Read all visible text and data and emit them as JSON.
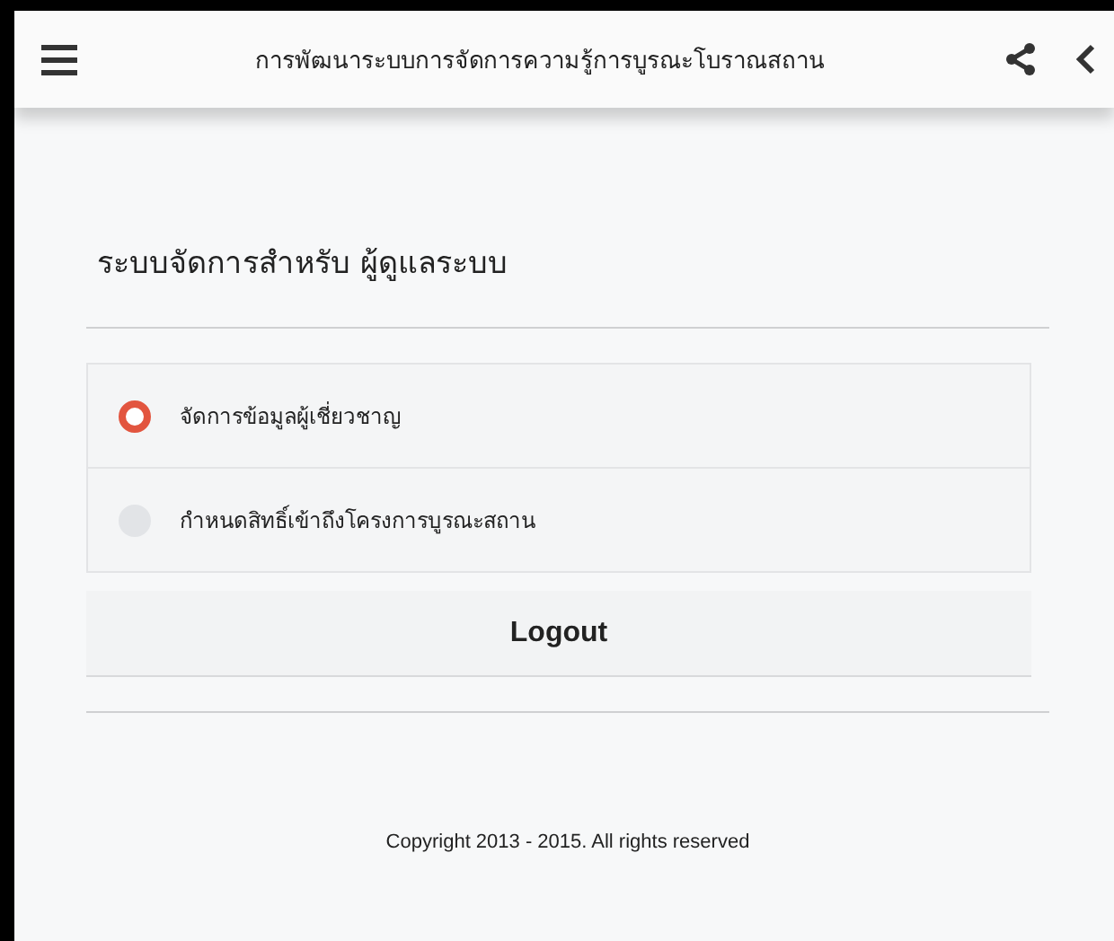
{
  "header": {
    "title": "การพัฒนาระบบการจัดการความรู้การบูรณะโบราณสถาน"
  },
  "page": {
    "heading": "ระบบจัดการสำหรับ ผู้ดูแลระบบ"
  },
  "menu": [
    {
      "label": "จัดการข้อมูลผู้เชี่ยวชาญ",
      "selected": true
    },
    {
      "label": "กำหนดสิทธิ์เข้าถึงโครงการบูรณะสถาน",
      "selected": false
    }
  ],
  "logout_button": "Logout",
  "footer": "Copyright 2013 - 2015. All rights reserved"
}
